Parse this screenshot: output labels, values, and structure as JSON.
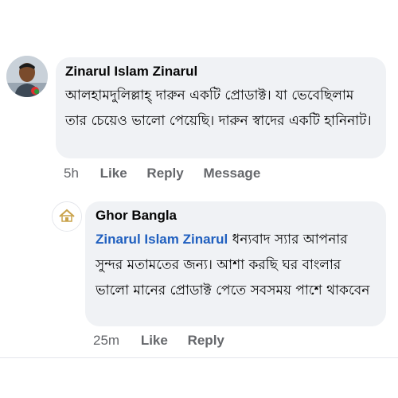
{
  "comment": {
    "author": "Zinarul Islam Zinarul",
    "text": "আলহামদুলিল্লাহ্ দারুন একটি প্রোডাক্ট। যা ভেবেছিলাম তার চেয়েও ভালো পেয়েছি। দারুন স্বাদের একটি হানিনাট।",
    "time": "5h",
    "actions": {
      "like": "Like",
      "reply": "Reply",
      "message": "Message"
    }
  },
  "reply": {
    "author": "Ghor Bangla",
    "logo_text": "Ghor Bangla",
    "mention": "Zinarul Islam Zinarul",
    "text": " ধন্যবাদ স্যার আপনার সুন্দর মতামতের জন্য।  আশা করছি ঘর বাংলার ভালো মানের প্রোডাক্ট পেতে সবসময় পাশে থাকবেন",
    "time": "25m",
    "actions": {
      "like": "Like",
      "reply": "Reply"
    }
  },
  "colors": {
    "bubble": "#f0f2f5",
    "mention": "#1f5fbf",
    "muted": "#65676b",
    "brand": "#c9a24a"
  }
}
